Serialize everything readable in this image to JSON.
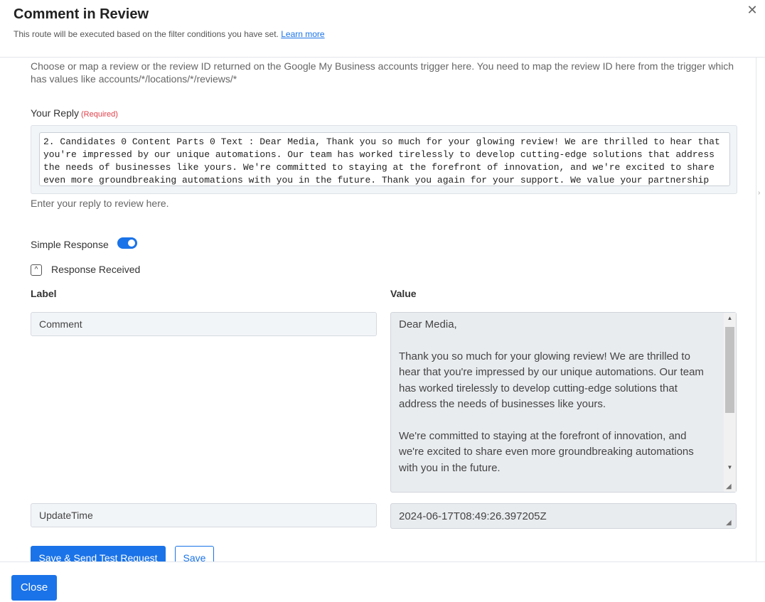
{
  "dialog": {
    "title": "Comment in Review",
    "subtitle": "This route will be executed based on the filter conditions you have set.",
    "learn_more": "Learn more",
    "close_glyph": "✕"
  },
  "review_field": {
    "description": "Choose or map a review or the review ID returned on the Google My Business accounts trigger here. You need to map the review ID here from the trigger which has values like accounts/*/locations/*/reviews/*"
  },
  "reply": {
    "label": "Your Reply",
    "required": "(Required)",
    "value": "2. Candidates 0 Content Parts 0 Text : Dear Media, Thank you so much for your glowing review! We are thrilled to hear that you're impressed by our unique automations. Our team has worked tirelessly to develop cutting-edge solutions that address the needs of businesses like yours. We're committed to staying at the forefront of innovation, and we're excited to share even more groundbreaking automations with you in the future. Thank you again for your support. We value your partnership and look forward to continuing to serve your ...",
    "hint": "Enter your reply to review here."
  },
  "simple_response": {
    "label": "Simple Response",
    "enabled": true
  },
  "response_received": {
    "label": "Response Received",
    "expanded": true,
    "col_label": "Label",
    "col_value": "Value",
    "rows": [
      {
        "label": "Comment",
        "value": "Dear Media,\n\nThank you so much for your glowing review! We are thrilled to hear that you're impressed by our unique automations. Our team has worked tirelessly to develop cutting-edge solutions that address the needs of businesses like yours.\n\nWe're committed to staying at the forefront of innovation, and we're excited to share even more groundbreaking automations with you in the future."
      },
      {
        "label": "UpdateTime",
        "value": "2024-06-17T08:49:26.397205Z"
      }
    ]
  },
  "actions": {
    "save_send": "Save & Send Test Request",
    "save": "Save"
  },
  "footer": {
    "close": "Close"
  },
  "colors": {
    "primary": "#1a73e8",
    "required": "#e0404a"
  }
}
